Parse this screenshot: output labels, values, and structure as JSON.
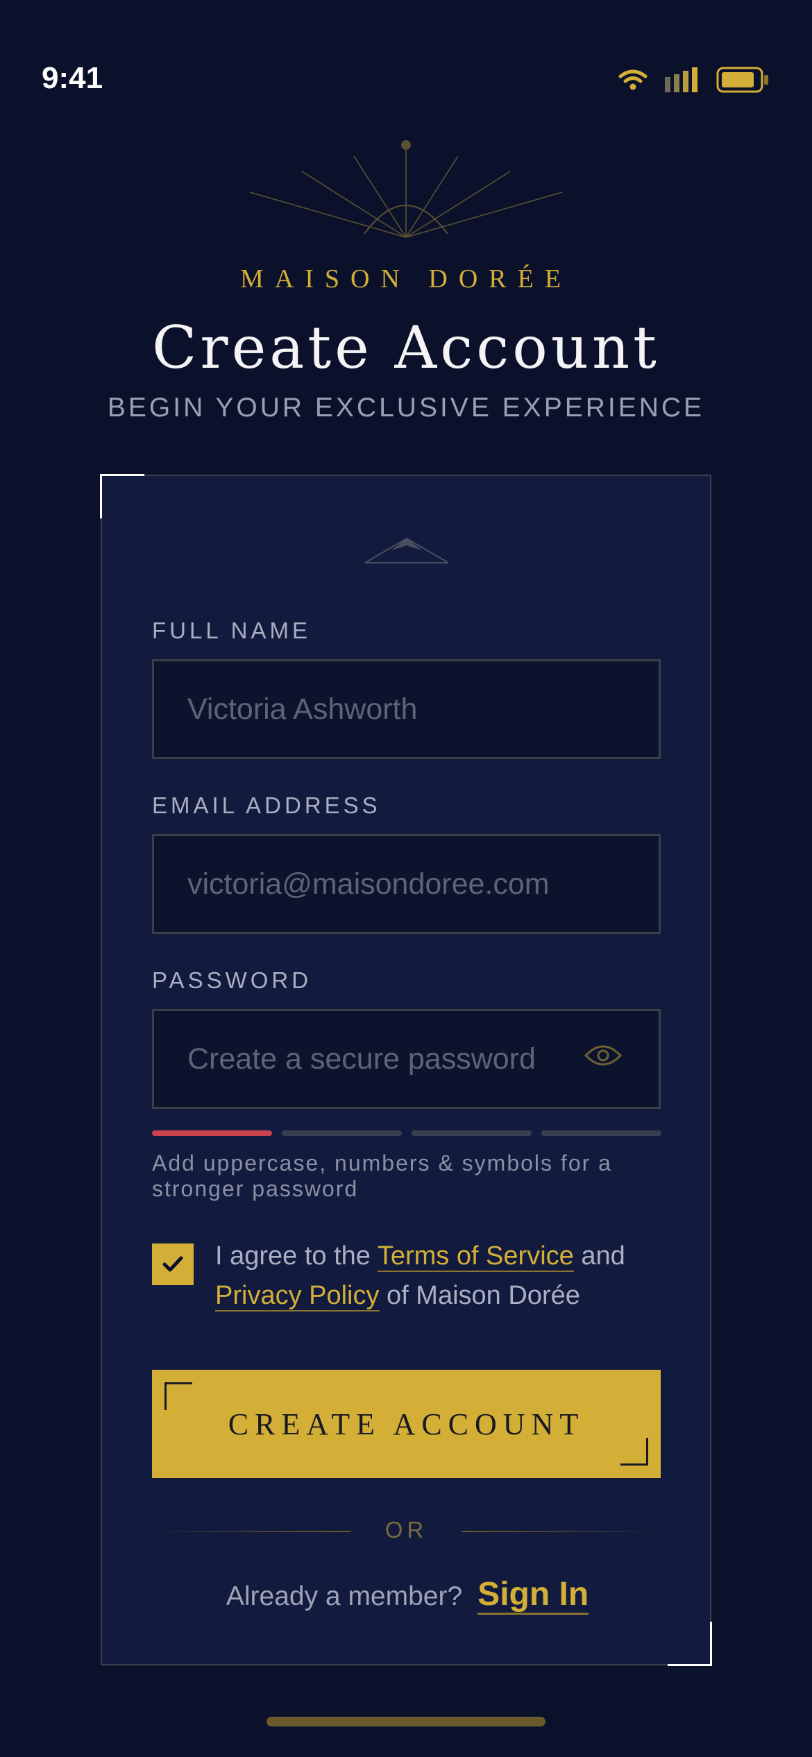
{
  "status_bar": {
    "time": "9:41"
  },
  "header": {
    "brand": "MAISON DORÉE",
    "title": "Create Account",
    "subtitle": "BEGIN YOUR EXCLUSIVE EXPERIENCE"
  },
  "form": {
    "full_name": {
      "label": "FULL NAME",
      "placeholder": "Victoria Ashworth",
      "value": ""
    },
    "email": {
      "label": "EMAIL ADDRESS",
      "placeholder": "victoria@maisondoree.com",
      "value": ""
    },
    "password": {
      "label": "PASSWORD",
      "placeholder": "Create a secure password",
      "value": ""
    },
    "password_strength": {
      "level": 1,
      "of": 4,
      "hint": "Add uppercase, numbers & symbols for a stronger password"
    },
    "terms": {
      "checked": true,
      "prefix": "I agree to the ",
      "terms_link": "Terms of Service",
      "middle": " and",
      "privacy_link": "Privacy Policy",
      "suffix": " of Maison Dorée"
    },
    "submit_label": "CREATE ACCOUNT",
    "divider_text": "OR",
    "member_prompt": "Already a member?",
    "sign_in_label": "Sign In"
  },
  "colors": {
    "background": "#0b112a",
    "card": "#121b3e",
    "gold": "#d4af37",
    "strength_weak": "#c8434c"
  }
}
